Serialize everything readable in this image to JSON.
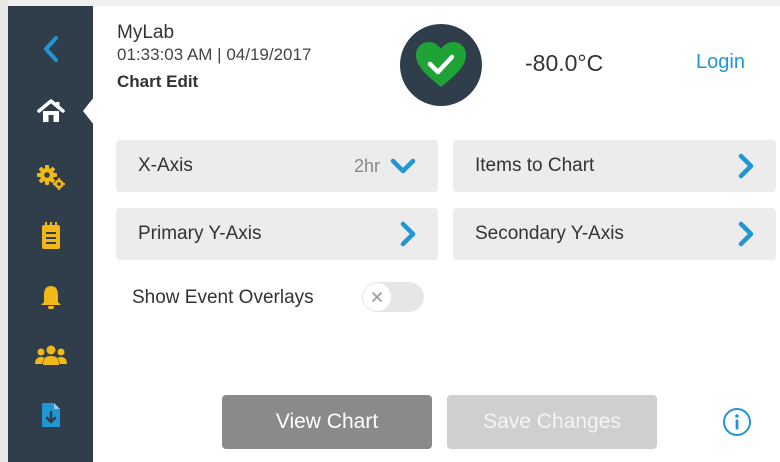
{
  "header": {
    "app_name": "MyLab",
    "datetime": "01:33:03 AM | 04/19/2017",
    "page_title": "Chart Edit",
    "temperature": "-80.0°C",
    "login_label": "Login",
    "status_icon": "heart-check-icon"
  },
  "sidebar": {
    "items": [
      {
        "icon": "back-chevron-icon"
      },
      {
        "icon": "home-icon",
        "active": true
      },
      {
        "icon": "settings-gears-icon"
      },
      {
        "icon": "clipboard-icon"
      },
      {
        "icon": "bell-icon"
      },
      {
        "icon": "users-icon"
      },
      {
        "icon": "file-download-icon"
      }
    ]
  },
  "settings": {
    "x_axis": {
      "label": "X-Axis",
      "value": "2hr"
    },
    "items_to_chart": {
      "label": "Items to Chart"
    },
    "primary_y": {
      "label": "Primary Y-Axis"
    },
    "secondary_y": {
      "label": "Secondary Y-Axis"
    },
    "event_overlays": {
      "label": "Show Event Overlays",
      "enabled": false
    }
  },
  "actions": {
    "view_chart": "View Chart",
    "save_changes": "Save Changes"
  },
  "colors": {
    "sidebar": "#2f3e4a",
    "accent": "#2196d3",
    "status_ok": "#1fa336"
  }
}
